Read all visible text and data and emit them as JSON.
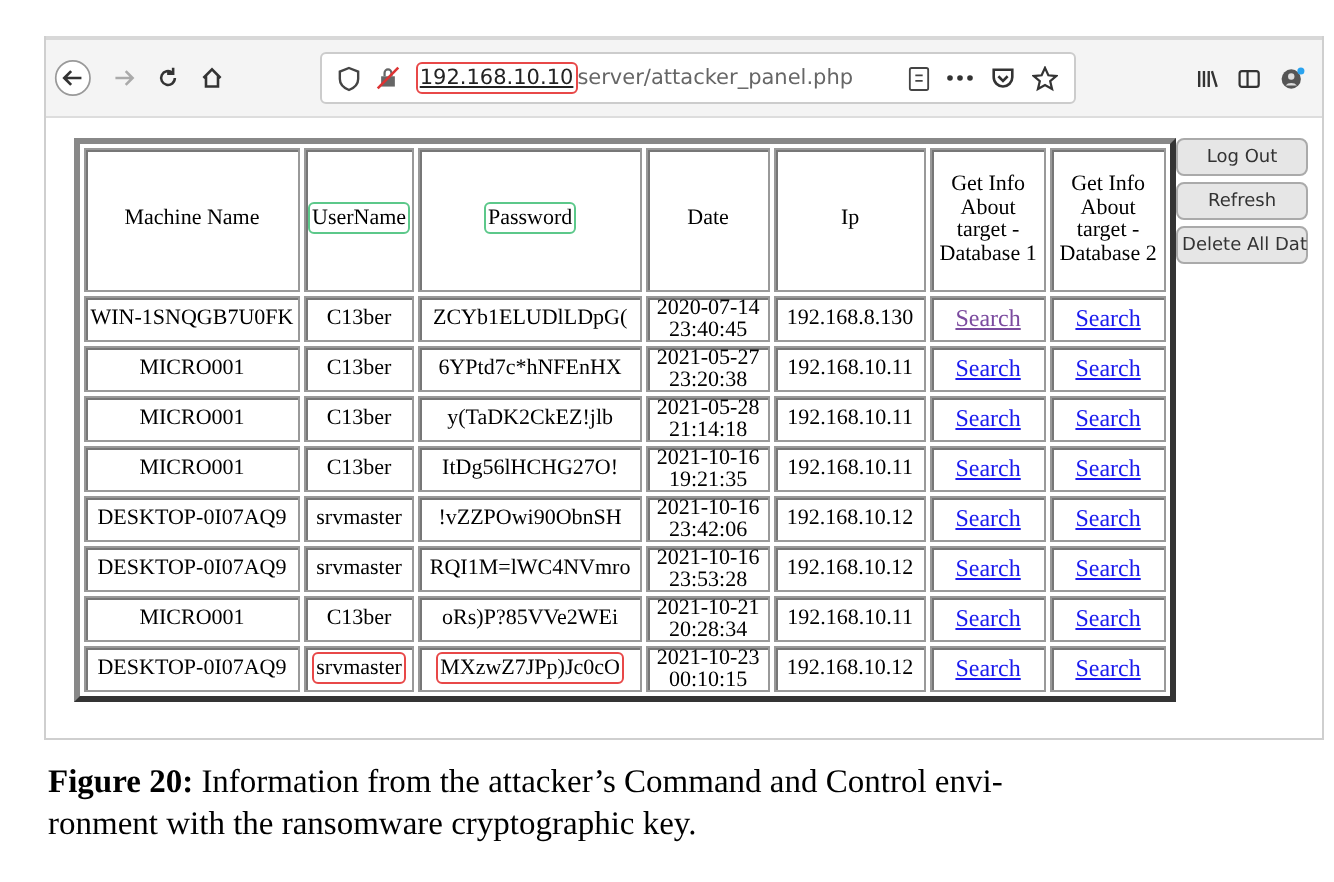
{
  "browser": {
    "address": {
      "host": "192.168.10.10",
      "color": "#e84848",
      "path": "server/attacker_panel.php"
    }
  },
  "table": {
    "columns": [
      {
        "label": "Machine Name"
      },
      {
        "label": "UserName",
        "color": "#5cc88a"
      },
      {
        "label": "Password",
        "color": "#5cc88a"
      },
      {
        "label": "Date"
      },
      {
        "label": "Ip"
      },
      {
        "label": "Get Info About target - Database 1"
      },
      {
        "label": "Get Info About target - Database 2"
      }
    ],
    "rows": [
      {
        "machine": "WIN-1SNQGB7U0FK",
        "user": "C13ber",
        "password": "ZCYb1ELUDlLDpG(",
        "date": "2020-07-14 23:40:45",
        "ip": "192.168.8.130",
        "links": [
          {
            "label": "Search",
            "visited": true
          },
          {
            "label": "Search",
            "visited": false
          }
        ]
      },
      {
        "machine": "MICRO001",
        "user": "C13ber",
        "password": "6YPtd7c*hNFEnHX",
        "date": "2021-05-27 23:20:38",
        "ip": "192.168.10.11",
        "links": [
          {
            "label": "Search",
            "visited": false
          },
          {
            "label": "Search",
            "visited": false
          }
        ]
      },
      {
        "machine": "MICRO001",
        "user": "C13ber",
        "password": "y(TaDK2CkEZ!jlb",
        "date": "2021-05-28 21:14:18",
        "ip": "192.168.10.11",
        "links": [
          {
            "label": "Search",
            "visited": false
          },
          {
            "label": "Search",
            "visited": false
          }
        ]
      },
      {
        "machine": "MICRO001",
        "user": "C13ber",
        "password": "ItDg56lHCHG27O!",
        "date": "2021-10-16 19:21:35",
        "ip": "192.168.10.11",
        "links": [
          {
            "label": "Search",
            "visited": false
          },
          {
            "label": "Search",
            "visited": false
          }
        ]
      },
      {
        "machine": "DESKTOP-0I07AQ9",
        "user": "srvmaster",
        "password": "!vZZPOwi90ObnSH",
        "date": "2021-10-16 23:42:06",
        "ip": "192.168.10.12",
        "links": [
          {
            "label": "Search",
            "visited": false
          },
          {
            "label": "Search",
            "visited": false
          }
        ]
      },
      {
        "machine": "DESKTOP-0I07AQ9",
        "user": "srvmaster",
        "password": "RQI1M=lWC4NVmro",
        "date": "2021-10-16 23:53:28",
        "ip": "192.168.10.12",
        "links": [
          {
            "label": "Search",
            "visited": false
          },
          {
            "label": "Search",
            "visited": false
          }
        ]
      },
      {
        "machine": "MICRO001",
        "user": "C13ber",
        "password": "oRs)P?85VVe2WEi",
        "date": "2021-10-21 20:28:34",
        "ip": "192.168.10.11",
        "links": [
          {
            "label": "Search",
            "visited": false
          },
          {
            "label": "Search",
            "visited": false
          }
        ]
      },
      {
        "machine": "DESKTOP-0I07AQ9",
        "user": "srvmaster",
        "password": "MXzwZ7JPp)Jc0cO",
        "date": "2021-10-23 00:10:15",
        "ip": "192.168.10.12",
        "color": "#e84848",
        "links": [
          {
            "label": "Search",
            "visited": false
          },
          {
            "label": "Search",
            "visited": false
          }
        ]
      }
    ]
  },
  "side_buttons": [
    {
      "label": "Log Out"
    },
    {
      "label": "Refresh"
    },
    {
      "label": "Delete All Dat"
    }
  ],
  "caption": "**Figure 20:** Information from the attacker’s Command and Control envi-\nronment with the ransomware cryptographic key."
}
